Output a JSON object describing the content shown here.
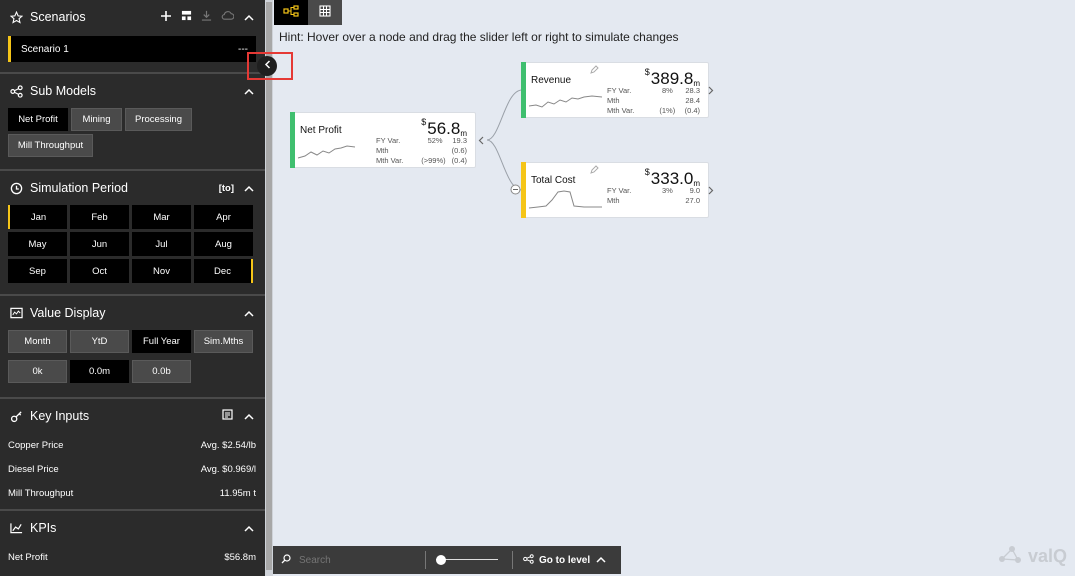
{
  "scenarios": {
    "title": "Scenarios",
    "current": "Scenario 1",
    "current_menu": "---"
  },
  "submodels": {
    "title": "Sub Models",
    "buttons": [
      "Net Profit",
      "Mining",
      "Processing",
      "Mill Throughput"
    ]
  },
  "simulation": {
    "title": "Simulation Period",
    "range_label": "[to]",
    "months": [
      "Jan",
      "Feb",
      "Mar",
      "Apr",
      "May",
      "Jun",
      "Jul",
      "Aug",
      "Sep",
      "Oct",
      "Nov",
      "Dec"
    ]
  },
  "value_display": {
    "title": "Value Display",
    "periods": [
      "Month",
      "YtD",
      "Full Year",
      "Sim.Mths"
    ],
    "formats": [
      "0k",
      "0.0m",
      "0.0b"
    ]
  },
  "key_inputs": {
    "title": "Key Inputs",
    "items": [
      {
        "label": "Copper Price",
        "value": "Avg. $2.54/lb"
      },
      {
        "label": "Diesel Price",
        "value": "Avg. $0.969/l"
      },
      {
        "label": "Mill Throughput",
        "value": "11.95m t"
      }
    ]
  },
  "kpis": {
    "title": "KPIs",
    "items": [
      {
        "label": "Net Profit",
        "value": "$56.8m"
      }
    ]
  },
  "hint": "Hint: Hover over a node and drag the slider left or right to simulate changes",
  "nodes": {
    "net_profit": {
      "name": "Net Profit",
      "currency": "$",
      "value": "56.8",
      "unit": "m",
      "rows": [
        [
          "FY Var.",
          "52%",
          "19.3"
        ],
        [
          "Mth",
          "",
          "(0.6)"
        ],
        [
          "Mth Var.",
          "(>99%)",
          "(0.4)"
        ]
      ],
      "color": "#3fbf6f"
    },
    "revenue": {
      "name": "Revenue",
      "currency": "$",
      "value": "389.8",
      "unit": "m",
      "rows": [
        [
          "FY Var.",
          "8%",
          "28.3"
        ],
        [
          "Mth",
          "",
          "28.4"
        ],
        [
          "Mth Var.",
          "(1%)",
          "(0.4)"
        ]
      ],
      "color": "#3fbf6f"
    },
    "total_cost": {
      "name": "Total Cost",
      "currency": "$",
      "value": "333.0",
      "unit": "m",
      "rows": [
        [
          "FY Var.",
          "3%",
          "9.0"
        ],
        [
          "Mth",
          "",
          "27.0"
        ]
      ],
      "color": "#f5c518"
    }
  },
  "toolbar": {
    "search_placeholder": "Search",
    "goto_label": "Go to level"
  },
  "logo": "valQ",
  "colors": {
    "accent": "#f5c518",
    "positive": "#3fbf6f",
    "sidebar": "#2b2b2b"
  }
}
